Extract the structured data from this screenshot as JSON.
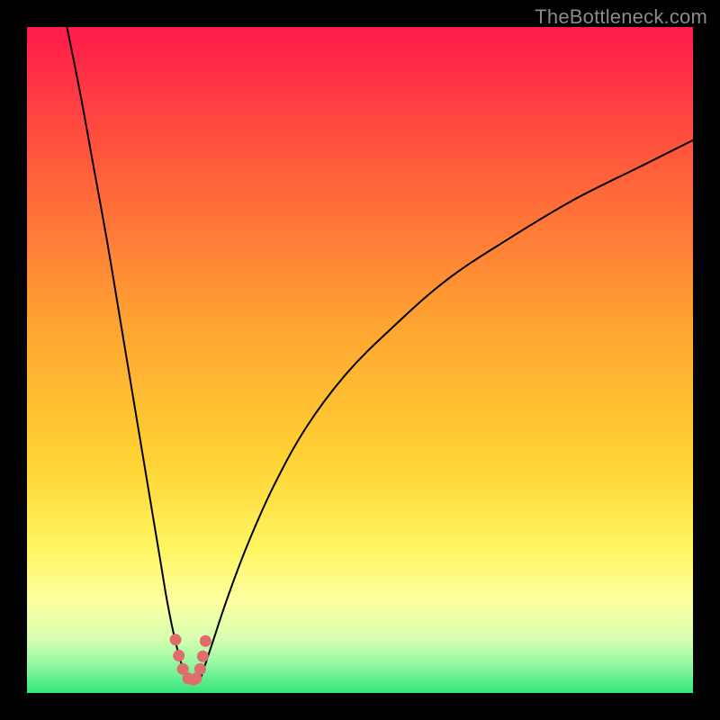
{
  "watermark": "TheBottleneck.com",
  "chart_data": {
    "type": "line",
    "title": "",
    "xlabel": "",
    "ylabel": "",
    "xlim": [
      0,
      100
    ],
    "ylim": [
      0,
      100
    ],
    "grid": false,
    "legend": false,
    "background_gradient": {
      "stops": [
        {
          "offset": 0.0,
          "color": "#ff1a4b"
        },
        {
          "offset": 0.2,
          "color": "#ff5a3c"
        },
        {
          "offset": 0.45,
          "color": "#ffa531"
        },
        {
          "offset": 0.65,
          "color": "#ffd233"
        },
        {
          "offset": 0.78,
          "color": "#fff560"
        },
        {
          "offset": 0.86,
          "color": "#fdffa0"
        },
        {
          "offset": 0.92,
          "color": "#d6ffb0"
        },
        {
          "offset": 0.96,
          "color": "#8cf7a0"
        },
        {
          "offset": 1.0,
          "color": "#34e57a"
        }
      ]
    },
    "optimal_x": 25,
    "series": [
      {
        "name": "left-branch",
        "x": [
          6,
          8,
          10,
          12,
          14,
          16,
          18,
          20,
          21,
          22,
          23,
          24
        ],
        "y": [
          100,
          90,
          79,
          68,
          56,
          44,
          32,
          20,
          14,
          9,
          5,
          2
        ]
      },
      {
        "name": "right-branch",
        "x": [
          26,
          27,
          28,
          30,
          33,
          37,
          42,
          48,
          55,
          63,
          72,
          82,
          92,
          100
        ],
        "y": [
          2,
          5,
          8,
          14,
          22,
          31,
          40,
          48,
          55,
          62,
          68,
          74,
          79,
          83
        ]
      }
    ],
    "dip_marker": {
      "color": "#e06d6d",
      "points_left": [
        {
          "x": 22.3,
          "y": 8.0
        },
        {
          "x": 22.8,
          "y": 5.6
        },
        {
          "x": 23.4,
          "y": 3.6
        },
        {
          "x": 24.2,
          "y": 2.2
        }
      ],
      "points_right": [
        {
          "x": 26.8,
          "y": 7.8
        },
        {
          "x": 26.4,
          "y": 5.5
        },
        {
          "x": 26.0,
          "y": 3.6
        },
        {
          "x": 25.4,
          "y": 2.2
        }
      ],
      "bottom": [
        {
          "x": 24.2,
          "y": 2.2
        },
        {
          "x": 25.0,
          "y": 1.8
        },
        {
          "x": 25.4,
          "y": 2.2
        }
      ]
    }
  }
}
